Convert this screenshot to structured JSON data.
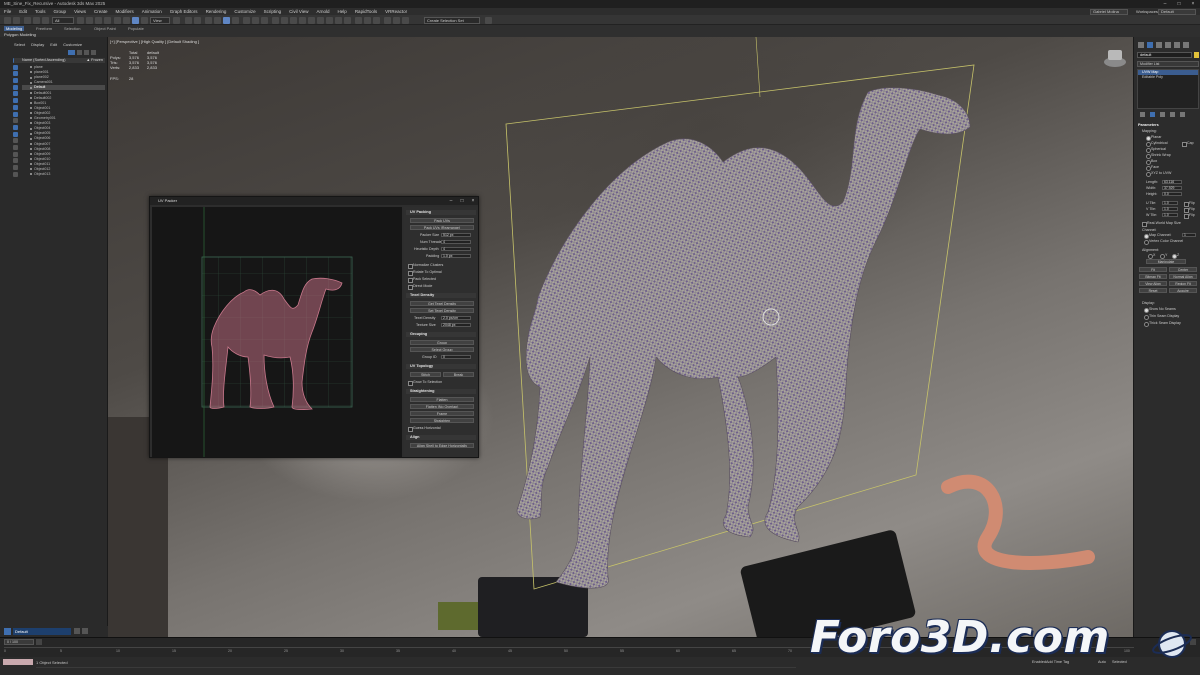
{
  "window": {
    "title": "ME_Sine_Fix_Recursive - Autodesk 3ds Max 2025"
  },
  "menu": {
    "items": [
      "File",
      "Edit",
      "Tools",
      "Group",
      "Views",
      "Create",
      "Modifiers",
      "Animation",
      "Graph Editors",
      "Rendering",
      "Customize",
      "Scripting",
      "Civil View",
      "Arnold",
      "Help",
      "RapidTools",
      "VRReactor"
    ],
    "user": "Gabriel Molina",
    "workspace_label": "Workspaces:",
    "workspace_value": "Default"
  },
  "toolbar": {
    "selection_set": "View",
    "named_set": "Create Selection Set"
  },
  "ribbon": {
    "tabs": [
      "Modeling",
      "Freeform",
      "Selection",
      "Object Paint",
      "Populate"
    ],
    "active_tab": "Modeling",
    "subtitle": "Polygon Modeling"
  },
  "explorer": {
    "tabs": [
      "Select",
      "Display",
      "Edit",
      "Customize"
    ],
    "column_header": "Name (Sorted Ascending)",
    "frozen_label": "▲ Frozen",
    "objects": [
      "plane",
      "plane001",
      "plane002",
      "Camera001",
      "Default",
      "Default001",
      "Default002",
      "Box001",
      "Object001",
      "Object002",
      "Geometry001",
      "Object003",
      "Object004",
      "Object005",
      "Object006",
      "Object007",
      "Object008",
      "Object009",
      "Object010",
      "Object011",
      "Object012",
      "Object013"
    ],
    "selected_index": 4,
    "layer": "Default"
  },
  "viewport": {
    "label": "[+] [Perspective ] [High Quality ] [Default Shading ]",
    "stats": {
      "headers": [
        "Total",
        "default"
      ],
      "rows": [
        {
          "label": "Polys:",
          "total": "3,576",
          "sel": "3,576"
        },
        {
          "label": "Tris:",
          "total": "3,576",
          "sel": "3,576"
        },
        {
          "label": "Verts:",
          "total": "2,833",
          "sel": "2,833"
        }
      ],
      "fps_label": "FPS:",
      "fps": "28"
    }
  },
  "uv_editor": {
    "title": "UV Packer",
    "sections": {
      "packing": "UV Packing",
      "texel": "Texel Density",
      "grouping": "Grouping",
      "topology": "UV Topology",
      "straighten": "Straightening",
      "align": "Align"
    },
    "buttons": {
      "pack": "Pack UVs",
      "pack_rearrange": "Pack UVs (Rearrange)",
      "get_texel": "Get Texel Density",
      "set_texel": "Set Texel Density",
      "group": "Group",
      "select_group": "Select Group",
      "stitch": "Stitch",
      "break": "Break",
      "flatten": "Flatten",
      "flatten_overlap": "Flatten (No Overlap)",
      "frame": "Frame",
      "straighten": "Straighten",
      "align": "Align Shell to Edge Horizontally"
    },
    "fields": [
      {
        "label": "Packer Size",
        "value": "512 px"
      },
      {
        "label": "Num Threads",
        "value": "4"
      },
      {
        "label": "Heuristic Depth",
        "value": "4"
      },
      {
        "label": "Padding",
        "value": "1.0 px"
      }
    ],
    "checks": [
      "Normalize Clusters",
      "Rotate To Optimal",
      "Pack Selected",
      "Direct Mode"
    ],
    "texel_fields": [
      {
        "label": "Texel Density",
        "value": "2.0 px/cm"
      },
      {
        "label": "Texture Size",
        "value": "2048 px"
      }
    ],
    "group_id_label": "Group ID",
    "group_id": "0",
    "grow_label": "Grow To Selection",
    "guess_label": "Guess Horizontal"
  },
  "command_panel": {
    "object_name": "default",
    "modifier_list": "Modifier List",
    "stack": [
      "UVW Map",
      "Editable Poly"
    ],
    "rollout": "Parameters",
    "mapping_label": "Mapping:",
    "mapping_options": [
      "Planar",
      "Cylindrical",
      "Spherical",
      "Shrink Wrap",
      "Box",
      "Face",
      "XYZ to UVW"
    ],
    "cap_label": "Cap",
    "length_label": "Length:",
    "length": "63.116",
    "width_label": "Width:",
    "width": "37.929",
    "height_label": "Height:",
    "height": "0.0",
    "u_tile_label": "U Tile:",
    "u_tile": "1.0",
    "v_tile_label": "V Tile:",
    "v_tile": "1.0",
    "w_tile_label": "W Tile:",
    "w_tile": "1.0",
    "flip_label": "Flip",
    "real_world": "Real-World Map Size",
    "channel_label": "Channel:",
    "map_channel": "Map Channel:",
    "map_channel_value": "1",
    "vertex_color": "Vertex Color Channel",
    "alignment_label": "Alignment:",
    "axes": [
      "X",
      "Y",
      "Z"
    ],
    "manipulate": "Manipulate",
    "align_buttons": [
      "Fit",
      "Center",
      "Bitmap Fit",
      "Normal Align",
      "View Align",
      "Region Fit",
      "Reset",
      "Acquire"
    ],
    "display_label": "Display:",
    "display_options": [
      "Show No Seams",
      "Thin Seam Display",
      "Thick Seam Display"
    ]
  },
  "timeline": {
    "frame_counter": "0 / 100",
    "ticks": [
      "0",
      "5",
      "10",
      "15",
      "20",
      "25",
      "30",
      "35",
      "40",
      "45",
      "50",
      "55",
      "60",
      "65",
      "70",
      "75",
      "80",
      "85",
      "90",
      "95",
      "100"
    ]
  },
  "status": {
    "message": "1 Object Selected",
    "enabled": "Enabled",
    "add_time_tag": "Add Time Tag",
    "auto": "Auto",
    "selected": "Selected"
  },
  "watermark": "Foro3D.com"
}
